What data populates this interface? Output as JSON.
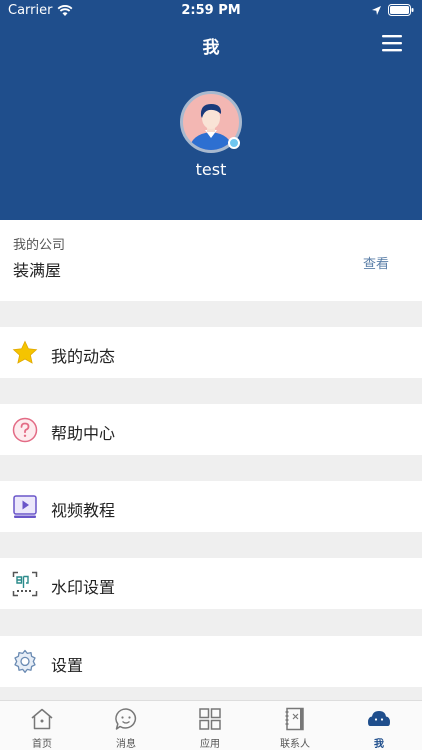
{
  "status_bar": {
    "carrier": "Carrier",
    "time": "2:59 PM"
  },
  "header": {
    "title": "我"
  },
  "profile": {
    "username": "test"
  },
  "company": {
    "label": "我的公司",
    "name": "装满屋",
    "view_label": "查看"
  },
  "menu": [
    {
      "label": "我的动态",
      "icon": "star-icon"
    },
    {
      "label": "帮助中心",
      "icon": "help-icon"
    },
    {
      "label": "视频教程",
      "icon": "video-icon"
    },
    {
      "label": "水印设置",
      "icon": "watermark-icon"
    },
    {
      "label": "设置",
      "icon": "gear-icon"
    }
  ],
  "tabs": [
    {
      "label": "首页",
      "icon": "home-icon"
    },
    {
      "label": "消息",
      "icon": "message-icon"
    },
    {
      "label": "应用",
      "icon": "apps-icon"
    },
    {
      "label": "联系人",
      "icon": "contacts-icon"
    },
    {
      "label": "我",
      "icon": "profile-icon",
      "active": true
    }
  ],
  "colors": {
    "primary": "#1f4e8c",
    "background": "#efefef",
    "link": "#5b7fa8",
    "star": "#f5c400"
  }
}
